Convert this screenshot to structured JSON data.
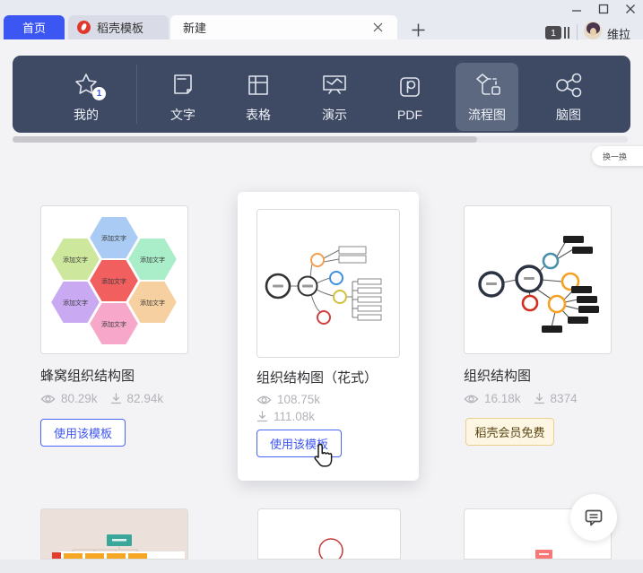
{
  "titlebar": {
    "tabs": [
      {
        "label": "首页"
      },
      {
        "label": "稻壳模板"
      },
      {
        "label": "新建"
      }
    ],
    "window_badge": "1",
    "user_name": "维拉"
  },
  "nav": {
    "items": [
      {
        "label": "我的",
        "badge": "1"
      },
      {
        "label": "文字"
      },
      {
        "label": "表格"
      },
      {
        "label": "演示"
      },
      {
        "label": "PDF"
      },
      {
        "label": "流程图",
        "selected": true
      },
      {
        "label": "脑图"
      }
    ]
  },
  "content": {
    "refresh_label": "换一换",
    "cards": [
      {
        "title": "蜂窝组织结构图",
        "views": "80.29k",
        "downloads": "82.94k",
        "action_label": "使用该模板",
        "hex_label": "添加文字"
      },
      {
        "title": "组织结构图（花式）",
        "views": "108.75k",
        "downloads": "111.08k",
        "action_label": "使用该模板"
      },
      {
        "title": "组织结构图",
        "views": "16.18k",
        "downloads": "8374",
        "badge_label": "稻壳会员免费"
      }
    ]
  },
  "colors": {
    "accent_blue": "#3c56f3",
    "nav_bg": "#3e4a63",
    "nav_selected": "#5c687f",
    "docer_red": "#e0392b",
    "member_badge_bg": "#fcf6e2",
    "hexagons": [
      "#a9cbf4",
      "#cde89c",
      "#a9eec9",
      "#f15f5f",
      "#c9aaf2",
      "#f7d0a1",
      "#f7a8ca"
    ]
  }
}
